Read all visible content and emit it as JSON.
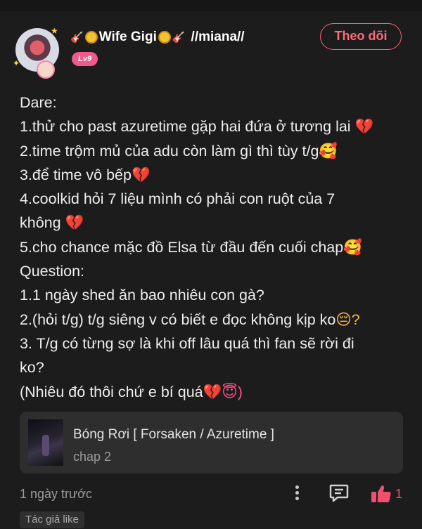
{
  "header": {
    "username": "🎸🪙Wife Gigi🪙🎸 //miana//",
    "username_parts": [
      "Wife Gigi",
      "//miana//"
    ],
    "level": "Lv9",
    "follow_label": "Theo dõi"
  },
  "post": {
    "lines": [
      {
        "text": "Dare:",
        "emoji": ""
      },
      {
        "text": "1.thử cho past azuretime gặp hai đứa ở tương lai ",
        "emoji": "💔"
      },
      {
        "text": "2.time trộm mủ của adu còn làm gì thì tùy t/g",
        "emoji": "🥰"
      },
      {
        "text": "3.để time vô bếp",
        "emoji": "💔"
      },
      {
        "text": "4.coolkid hỏi 7 liệu mình có phải con ruột của 7",
        "emoji": ""
      },
      {
        "text": "không ",
        "emoji": "💔"
      },
      {
        "text": "5.cho chance mặc đồ Elsa từ đầu đến cuối chap",
        "emoji": "🥰"
      },
      {
        "text": "Question:",
        "emoji": ""
      },
      {
        "text": "1.1 ngày shed ăn bao nhiêu con gà?",
        "emoji": ""
      },
      {
        "text": "2.(hỏi t/g) t/g siêng v có biết e đọc không kịp ko",
        "emoji": "😔?"
      },
      {
        "text": "3. T/g có từng sợ là khi off lâu quá thì fan sẽ rời đi",
        "emoji": ""
      },
      {
        "text": "ko?",
        "emoji": ""
      },
      {
        "text": "(Nhiêu đó thôi chứ e bí quá",
        "emoji": "💔😇)"
      }
    ]
  },
  "link_card": {
    "title": "Bóng Rơi [ Forsaken / Azuretime ]",
    "subtitle": "chap 2"
  },
  "footer": {
    "time": "1 ngày trước",
    "like_count": "1",
    "author_tag": "Tác giả like"
  },
  "colors": {
    "background": "#1c1c1c",
    "accent": "#ff5f73",
    "level_badge": "#f25a8e",
    "card": "#2e2e2e"
  },
  "icons": [
    "more-vertical-icon",
    "comment-icon",
    "like-thumb-icon"
  ]
}
